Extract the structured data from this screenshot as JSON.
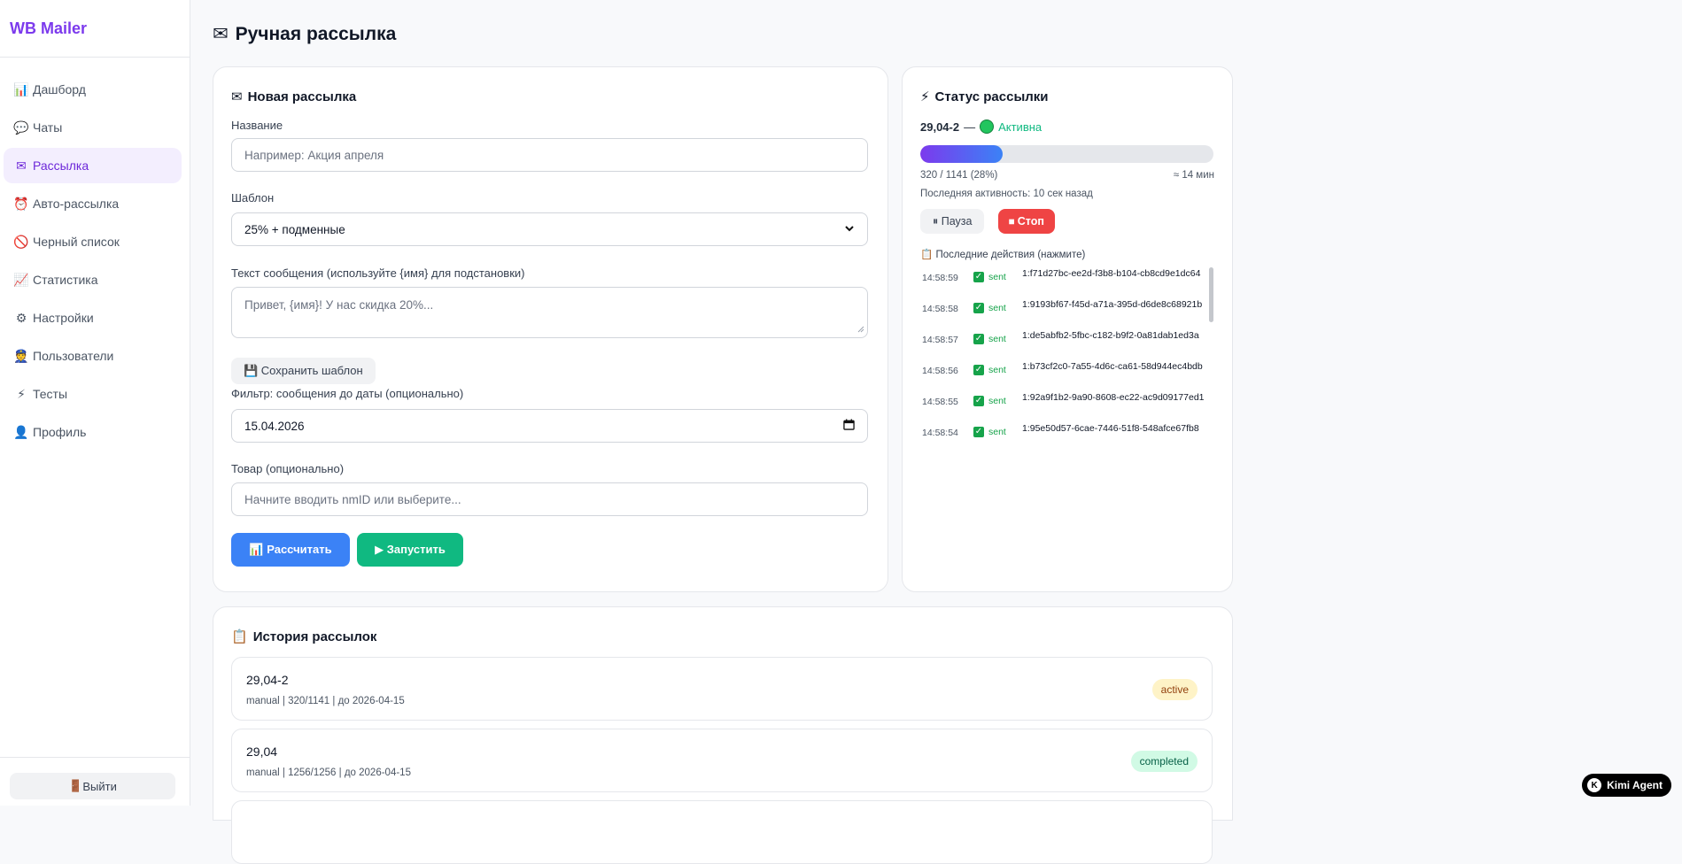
{
  "sidebar": {
    "brand": "WB Mailer",
    "items": [
      {
        "icon": "📊",
        "label": "Дашборд"
      },
      {
        "icon": "💬",
        "label": "Чаты"
      },
      {
        "icon": "✉",
        "label": "Рассылка"
      },
      {
        "icon": "⏰",
        "label": "Авто-рассылка"
      },
      {
        "icon": "🚫",
        "label": "Черный список"
      },
      {
        "icon": "📈",
        "label": "Статистика"
      },
      {
        "icon": "⚙",
        "label": "Настройки"
      },
      {
        "icon": "👮",
        "label": "Пользователи"
      },
      {
        "icon": "⚡",
        "label": "Тесты"
      },
      {
        "icon": "👤",
        "label": "Профиль"
      }
    ],
    "active_index": 2,
    "logout": {
      "icon": "🚪",
      "label": "Выйти"
    }
  },
  "page": {
    "title": "Ручная рассылка",
    "title_icon": "✉"
  },
  "new_mailing": {
    "title": "Новая рассылка",
    "name_label": "Название",
    "name_placeholder": "Например: Акция апреля",
    "template_label": "Шаблон",
    "template_value": "25% + подменные",
    "message_label": "Текст сообщения (используйте {имя} для подстановки)",
    "message_placeholder": "Привет, {имя}! У нас скидка 20%...",
    "save_template": "💾 Сохранить шаблон",
    "date_label": "Фильтр: сообщения до даты (опционально)",
    "date_value": "15.04.2026",
    "product_label": "Товар (опционально)",
    "product_placeholder": "Начните вводить nmID или выберите...",
    "calc_button": "📊 Рассчитать",
    "start_button": "▶ Запустить"
  },
  "status": {
    "title": "Статус рассылки",
    "mailing_name": "29,04-2",
    "separator": "—",
    "state": "Активна",
    "progress_fraction": 0.28,
    "progress_text": "320 / 1141 (28%)",
    "eta": "≈ 14 мин",
    "last_activity": "Последняя активность: 10 сек назад",
    "pause": "⏸ Пауза",
    "stop": "⏹ Стоп",
    "log_title": "📋 Последние действия (нажмите)",
    "log": [
      {
        "time": "14:58:59",
        "status": "sent",
        "id": "1:f71d27bc-ee2d-f3b8-b104-cb8cd9e1dc64"
      },
      {
        "time": "14:58:58",
        "status": "sent",
        "id": "1:9193bf67-f45d-a71a-395d-d6de8c68921b"
      },
      {
        "time": "14:58:57",
        "status": "sent",
        "id": "1:de5abfb2-5fbc-c182-b9f2-0a81dab1ed3a"
      },
      {
        "time": "14:58:56",
        "status": "sent",
        "id": "1:b73cf2c0-7a55-4d6c-ca61-58d944ec4bdb"
      },
      {
        "time": "14:58:55",
        "status": "sent",
        "id": "1:92a9f1b2-9a90-8608-ec22-ac9d09177ed1"
      },
      {
        "time": "14:58:54",
        "status": "sent",
        "id": "1:95e50d57-6cae-7446-51f8-548afce67fb8"
      }
    ]
  },
  "history": {
    "title": "История рассылок",
    "items": [
      {
        "name": "29,04-2",
        "meta": "manual | 320/1141 | до 2026-04-15",
        "status": "active"
      },
      {
        "name": "29,04",
        "meta": "manual | 1256/1256 | до 2026-04-15",
        "status": "completed"
      }
    ]
  },
  "badge": {
    "label": "Kimi Agent"
  },
  "colors": {
    "accent": "#7c3aed",
    "blue": "#3b82f6",
    "green": "#10b981",
    "red": "#ef4444"
  }
}
